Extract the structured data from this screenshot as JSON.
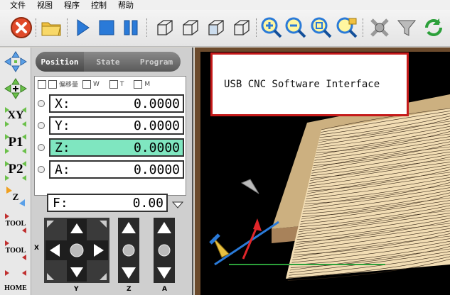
{
  "menu": {
    "items": [
      "文件",
      "视图",
      "程序",
      "控制",
      "帮助"
    ]
  },
  "toolbar": {
    "icons": [
      "stop-icon",
      "open-folder-icon",
      "play-icon",
      "stop-square-icon",
      "pause-icon",
      "view-iso-1-icon",
      "view-iso-2-icon",
      "view-iso-3-icon",
      "view-iso-4-icon",
      "zoom-in-icon",
      "zoom-out-icon",
      "zoom-fit-icon",
      "zoom-window-icon",
      "settings-icon",
      "filter-icon",
      "refresh-icon"
    ]
  },
  "leftcol": {
    "labels": [
      "",
      "",
      "XY",
      "P1",
      "P2",
      "Z",
      "TOOL",
      "TOOL",
      "HOME"
    ]
  },
  "panel": {
    "tabs": [
      "Position",
      "State",
      "Program"
    ],
    "checks": [
      "偏移量",
      "W",
      "T",
      "M"
    ],
    "axes": [
      {
        "label": "X:",
        "value": "0.0000"
      },
      {
        "label": "Y:",
        "value": "0.0000"
      },
      {
        "label": "Z:",
        "value": "0.0000"
      },
      {
        "label": "A:",
        "value": "0.0000"
      }
    ],
    "feed": {
      "label": "F:",
      "value": "0.00"
    },
    "pad_labels": {
      "x": "X",
      "y": "Y",
      "z": "Z",
      "a": "A"
    }
  },
  "banner": {
    "text": "USB CNC Software Interface"
  },
  "colors": {
    "selected_axis": "#7fe6c0",
    "banner_border": "#c51a1a",
    "model_fill": "#f2ddb4"
  }
}
